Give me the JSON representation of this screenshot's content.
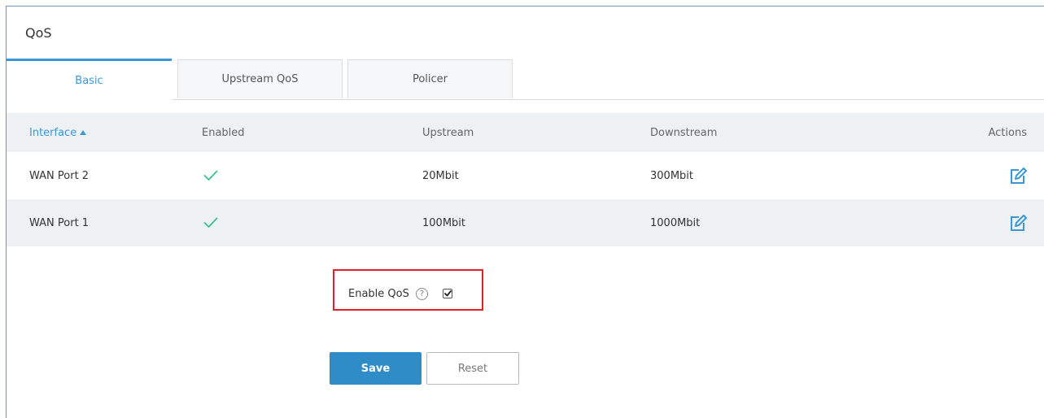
{
  "page": {
    "title": "QoS"
  },
  "tabs": [
    {
      "label": "Basic",
      "active": true
    },
    {
      "label": "Upstream QoS",
      "active": false
    },
    {
      "label": "Policer",
      "active": false
    }
  ],
  "table": {
    "columns": [
      "Interface",
      "Enabled",
      "Upstream",
      "Downstream",
      "Actions"
    ],
    "sort_column": "Interface",
    "sort_direction": "ascending",
    "rows": [
      {
        "interface": "WAN Port 2",
        "enabled": true,
        "upstream": "20Mbit",
        "downstream": "300Mbit",
        "action_icon": "edit-icon"
      },
      {
        "interface": "WAN Port 1",
        "enabled": true,
        "upstream": "100Mbit",
        "downstream": "1000Mbit",
        "action_icon": "edit-icon"
      }
    ]
  },
  "settings": {
    "enable_qos_label": "Enable QoS",
    "help_glyph": "?",
    "enable_qos_checked": true
  },
  "buttons": {
    "save_label": "Save",
    "reset_label": "Reset"
  },
  "colors": {
    "accent": "#3a98d4",
    "save_button": "#2f8cc7",
    "check": "#3cbf8a",
    "highlight_border": "#e3202a",
    "row_alt": "#eef1f4"
  }
}
